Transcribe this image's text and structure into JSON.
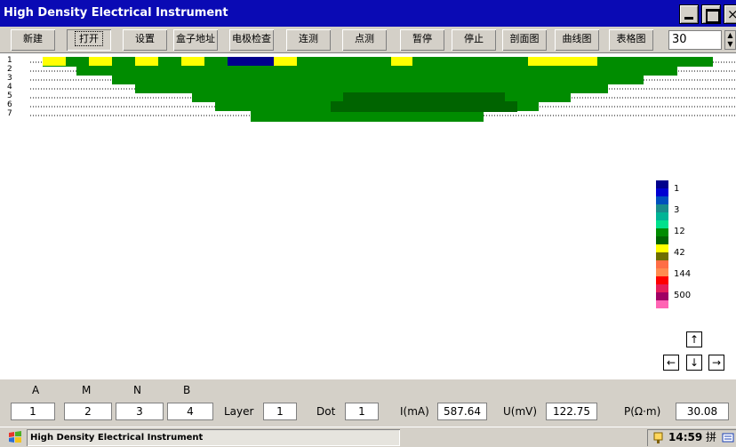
{
  "window": {
    "title": "High Density Electrical Instrument",
    "close_glyph": "×"
  },
  "toolbar": {
    "buttons": [
      "新建",
      "打开",
      "设置",
      "盒子地址",
      "电极检查",
      "连测",
      "点测",
      "暂停",
      "停止",
      "剖面图",
      "曲线图",
      "表格图"
    ],
    "active_index": 1,
    "zoom_value": "30",
    "spin_up": "▲",
    "spin_down": "▼"
  },
  "section": {
    "layer_labels": [
      "1",
      "2",
      "3",
      "4",
      "5",
      "6",
      "7"
    ],
    "legend": {
      "labels": [
        "1",
        "3",
        "12",
        "42",
        "144",
        "500"
      ],
      "colors": [
        "#00008c",
        "#0000d2",
        "#0050be",
        "#198c8c",
        "#00b496",
        "#00e18c",
        "#008c00",
        "#006400",
        "#ffff00",
        "#6e6e00",
        "#ff6e46",
        "#ff8c50",
        "#ff0000",
        "#e61e5a",
        "#a00064",
        "#ff64b4"
      ]
    },
    "nav": {
      "up": "↑",
      "left": "←",
      "down": "↓",
      "right": "→"
    },
    "colors": {
      "green": "#008c00",
      "dark_green": "#006400",
      "yellow": "#ffff00",
      "navy": "#00008c",
      "dots": "#000000"
    }
  },
  "params": {
    "electrodes": [
      {
        "label": "A",
        "value": "1"
      },
      {
        "label": "M",
        "value": "2"
      },
      {
        "label": "N",
        "value": "3"
      },
      {
        "label": "B",
        "value": "4"
      }
    ],
    "layer_label": "Layer",
    "layer_value": "1",
    "dot_label": "Dot",
    "dot_value": "1",
    "current_label": "I(mA)",
    "current_value": "587.64",
    "voltage_label": "U(mV)",
    "voltage_value": "122.75",
    "resistivity_label": "P(Ω·m)",
    "resistivity_value": "30.08"
  },
  "taskbar": {
    "task_label": "High Density Electrical Instrument",
    "clock": "14:59",
    "ime": "拼"
  }
}
